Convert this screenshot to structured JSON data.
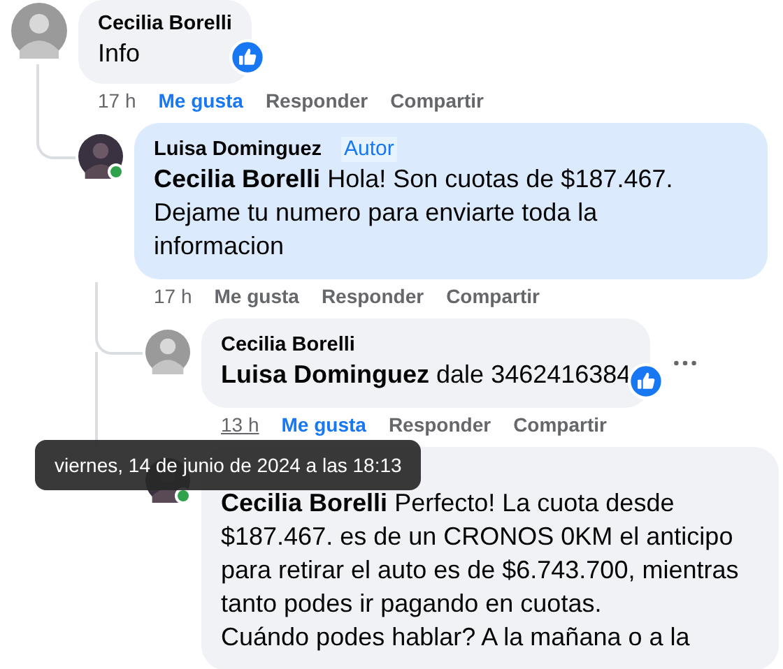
{
  "comments": [
    {
      "author": "Cecilia Borelli",
      "text": "Info",
      "highlighted": false,
      "reaction": true,
      "time": "17 h",
      "liked": true,
      "like_label": "Me gusta",
      "reply_label": "Responder",
      "share_label": "Compartir",
      "children": [
        {
          "author": "Luisa Dominguez",
          "author_badge": "Autor",
          "mention": "Cecilia Borelli",
          "text": "Hola! Son cuotas de $187.467. Dejame tu numero para enviarte toda la informacion",
          "highlighted": true,
          "online": true,
          "time": "17 h",
          "liked": false,
          "like_label": "Me gusta",
          "reply_label": "Responder",
          "share_label": "Compartir",
          "children": [
            {
              "author": "Cecilia Borelli",
              "mention": "Luisa Dominguez",
              "text": "dale 3462416384",
              "highlighted": false,
              "reaction": true,
              "more_menu": true,
              "time": "13 h",
              "time_hovered": true,
              "liked": true,
              "like_label": "Me gusta",
              "reply_label": "Responder",
              "share_label": "Compartir"
            },
            {
              "mention": "Cecilia Borelli",
              "text": "Perfecto! La cuota desde $187.467. es de un CRONOS 0KM el anticipo para retirar el auto es de $6.743.700, mientras tanto podes ir pagando en cuotas.\nCuándo podes hablar? A la mañana o a la",
              "highlighted": false,
              "online": true
            }
          ]
        }
      ]
    }
  ],
  "tooltip": {
    "text": "viernes, 14 de junio de 2024 a las 18:13"
  }
}
